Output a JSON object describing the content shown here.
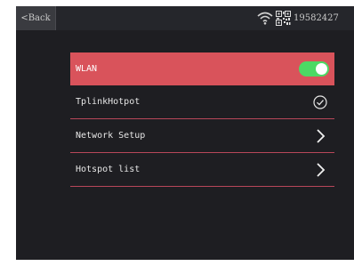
{
  "statusbar": {
    "back_label": "<Back",
    "device_id": "19582427",
    "icons": [
      "wifi-icon",
      "qr-code-icon"
    ]
  },
  "menu": {
    "items": [
      {
        "label": "WLAN",
        "control": "toggle",
        "state": "on",
        "highlighted": true
      },
      {
        "label": "TplinkHotpot",
        "control": "check-circle-icon"
      },
      {
        "label": "Network Setup",
        "control": "chevron-right-icon"
      },
      {
        "label": "Hotspot list",
        "control": "chevron-right-icon"
      }
    ]
  },
  "colors": {
    "screen_bg": "#1e1e22",
    "highlight": "#d9535b",
    "divider": "#b8475a",
    "toggle_on": "#4cd964"
  }
}
